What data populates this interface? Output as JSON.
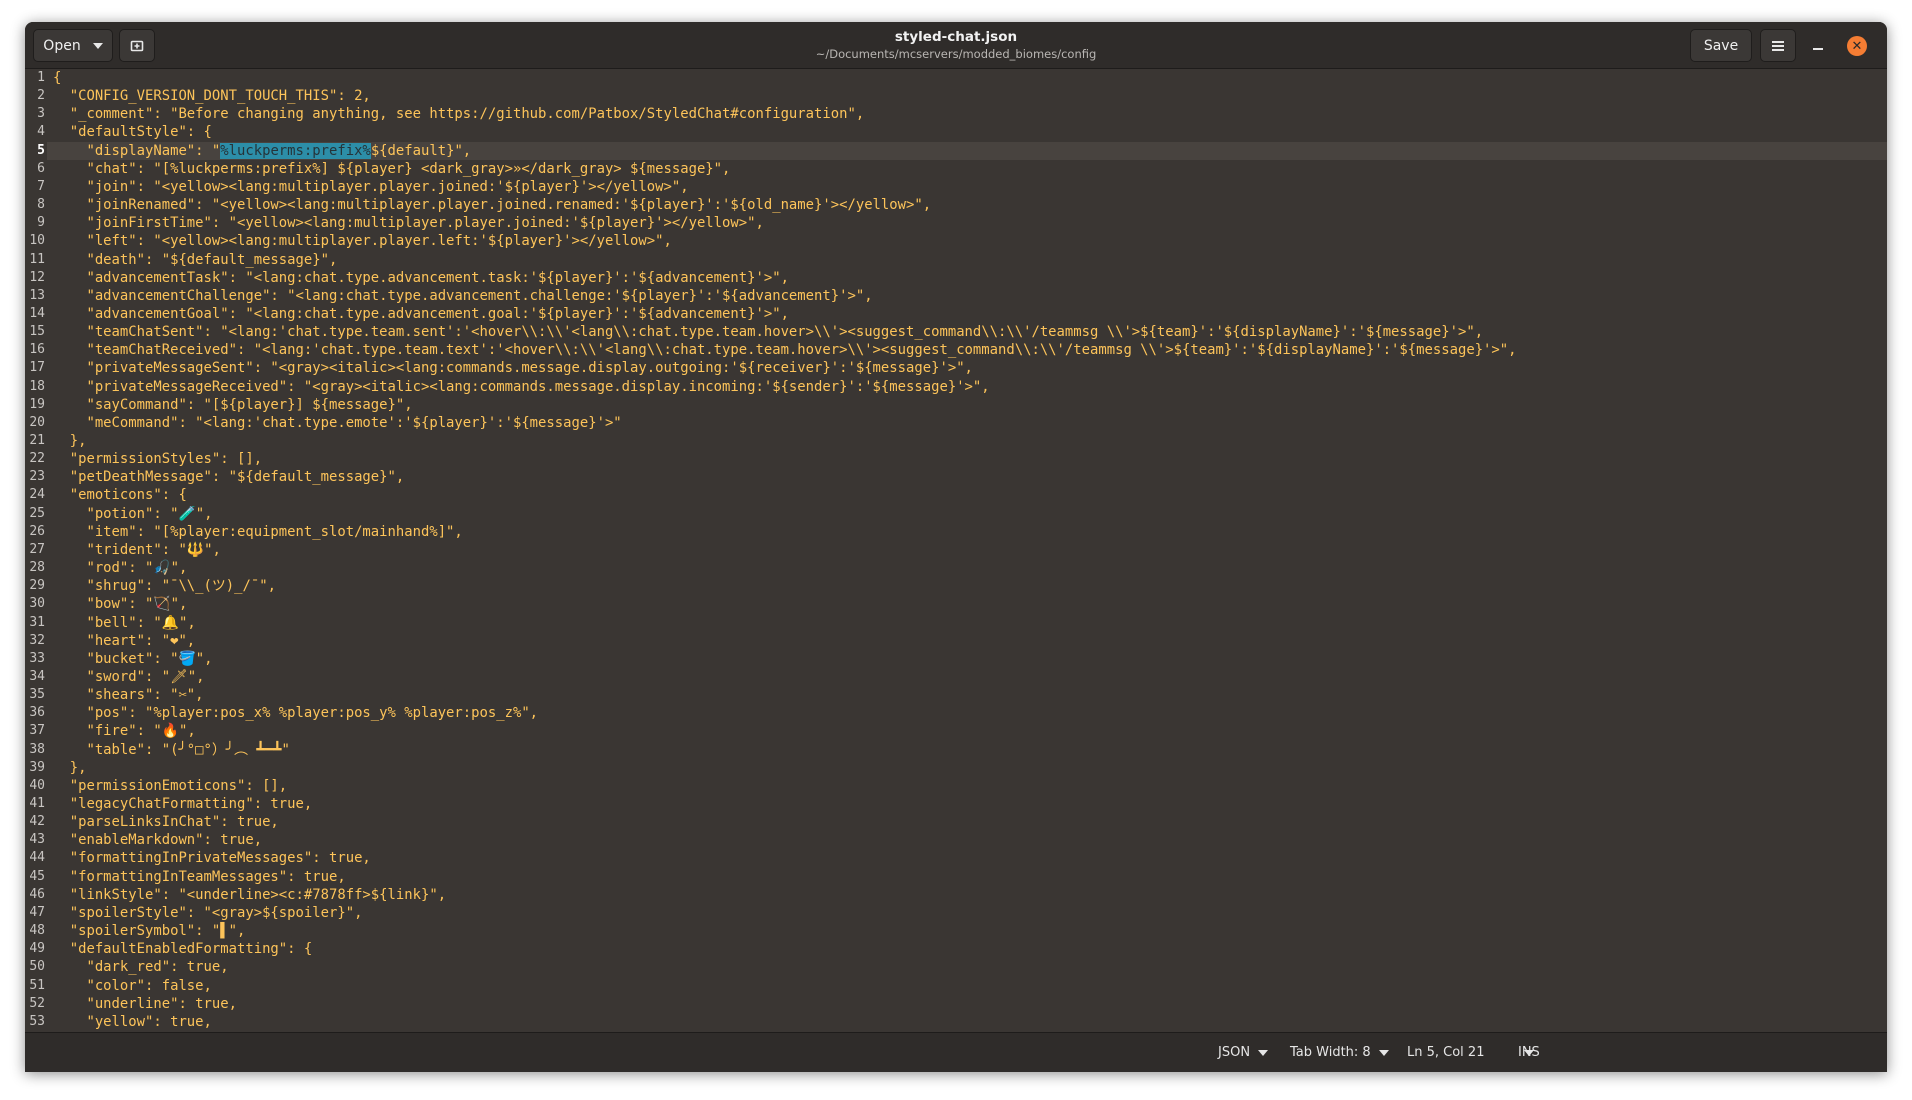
{
  "window": {
    "title": "styled-chat.json",
    "subtitle": "~/Documents/mcservers/modded_biomes/config"
  },
  "toolbar": {
    "open_label": "Open",
    "save_label": "Save"
  },
  "editor": {
    "current_line": 5,
    "lines": [
      "{",
      "  \"CONFIG_VERSION_DONT_TOUCH_THIS\": 2,",
      "  \"_comment\": \"Before changing anything, see https://github.com/Patbox/StyledChat#configuration\",",
      "  \"defaultStyle\": {",
      "    \"displayName\": \"%luckperms:prefix%${default}\",",
      "    \"chat\": \"[%luckperms:prefix%] ${player} <dark_gray>»</dark_gray> ${message}\",",
      "    \"join\": \"<yellow><lang:multiplayer.player.joined:'${player}'></yellow>\",",
      "    \"joinRenamed\": \"<yellow><lang:multiplayer.player.joined.renamed:'${player}':'${old_name}'></yellow>\",",
      "    \"joinFirstTime\": \"<yellow><lang:multiplayer.player.joined:'${player}'></yellow>\",",
      "    \"left\": \"<yellow><lang:multiplayer.player.left:'${player}'></yellow>\",",
      "    \"death\": \"${default_message}\",",
      "    \"advancementTask\": \"<lang:chat.type.advancement.task:'${player}':'${advancement}'>\",",
      "    \"advancementChallenge\": \"<lang:chat.type.advancement.challenge:'${player}':'${advancement}'>\",",
      "    \"advancementGoal\": \"<lang:chat.type.advancement.goal:'${player}':'${advancement}'>\",",
      "    \"teamChatSent\": \"<lang:'chat.type.team.sent':'<hover\\\\:\\\\'<lang\\\\:chat.type.team.hover>\\\\'><suggest_command\\\\:\\\\'/teammsg \\\\'>${team}':'${displayName}':'${message}'>\",",
      "    \"teamChatReceived\": \"<lang:'chat.type.team.text':'<hover\\\\:\\\\'<lang\\\\:chat.type.team.hover>\\\\'><suggest_command\\\\:\\\\'/teammsg \\\\'>${team}':'${displayName}':'${message}'>\",",
      "    \"privateMessageSent\": \"<gray><italic><lang:commands.message.display.outgoing:'${receiver}':'${message}'>\",",
      "    \"privateMessageReceived\": \"<gray><italic><lang:commands.message.display.incoming:'${sender}':'${message}'>\",",
      "    \"sayCommand\": \"[${player}] ${message}\",",
      "    \"meCommand\": \"<lang:'chat.type.emote':'${player}':'${message}'>\"",
      "  },",
      "  \"permissionStyles\": [],",
      "  \"petDeathMessage\": \"${default_message}\",",
      "  \"emoticons\": {",
      "    \"potion\": \"🧪\",",
      "    \"item\": \"[%player:equipment_slot/mainhand%]\",",
      "    \"trident\": \"🔱\",",
      "    \"rod\": \"🎣\",",
      "    \"shrug\": \"¯\\\\_(ツ)_/¯\",",
      "    \"bow\": \"🏹\",",
      "    \"bell\": \"🔔\",",
      "    \"heart\": \"❤\",",
      "    \"bucket\": \"🪣\",",
      "    \"sword\": \"🗡\",",
      "    \"shears\": \"✂\",",
      "    \"pos\": \"%player:pos_x% %player:pos_y% %player:pos_z%\",",
      "    \"fire\": \"🔥\",",
      "    \"table\": \"(╯°□°）╯︵ ┻━┻\"",
      "  },",
      "  \"permissionEmoticons\": [],",
      "  \"legacyChatFormatting\": true,",
      "  \"parseLinksInChat\": true,",
      "  \"enableMarkdown\": true,",
      "  \"formattingInPrivateMessages\": true,",
      "  \"formattingInTeamMessages\": true,",
      "  \"linkStyle\": \"<underline><c:#7878ff>${link}\",",
      "  \"spoilerStyle\": \"<gray>${spoiler}\",",
      "  \"spoilerSymbol\": \"▌\",",
      "  \"defaultEnabledFormatting\": {",
      "    \"dark_red\": true,",
      "    \"color\": false,",
      "    \"underline\": true,",
      "    \"yellow\": true,"
    ]
  },
  "statusbar": {
    "language": "JSON",
    "tab_width": "Tab Width: 8",
    "position": "Ln 5, Col 21",
    "mode": "INS"
  }
}
